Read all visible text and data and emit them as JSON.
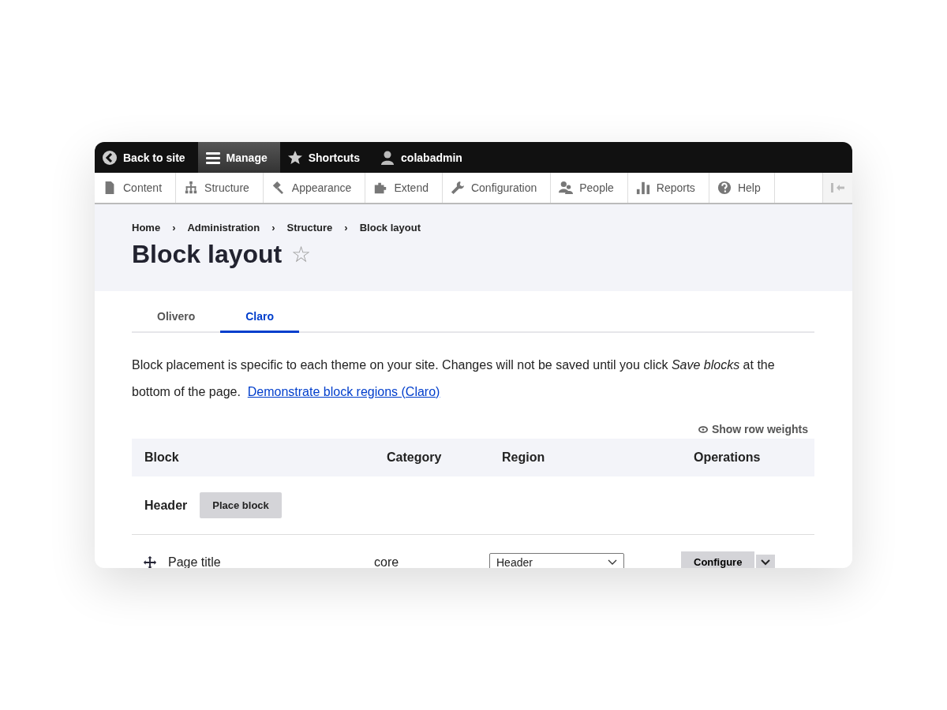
{
  "toolbar": {
    "items": [
      {
        "label": "Back to site",
        "selected": false
      },
      {
        "label": "Manage",
        "selected": true
      },
      {
        "label": "Shortcuts",
        "selected": false
      },
      {
        "label": "colabadmin",
        "selected": false
      }
    ]
  },
  "menu": {
    "items": [
      {
        "label": "Content"
      },
      {
        "label": "Structure"
      },
      {
        "label": "Appearance"
      },
      {
        "label": "Extend"
      },
      {
        "label": "Configuration"
      },
      {
        "label": "People"
      },
      {
        "label": "Reports"
      },
      {
        "label": "Help"
      }
    ]
  },
  "breadcrumb": [
    "Home",
    "Administration",
    "Structure",
    "Block layout"
  ],
  "breadcrumb_separator": "›",
  "page_title": "Block layout",
  "favorite_star": "☆",
  "tabs": [
    {
      "label": "Olivero",
      "selected": false
    },
    {
      "label": "Claro",
      "selected": true
    }
  ],
  "intro": {
    "text": "Block placement is specific to each theme on your site. Changes will not be saved until you click *Save blocks* at the bottom of the page.",
    "link": "Demonstrate block regions (Claro)"
  },
  "show_row_weights": "Show row weights",
  "table": {
    "columns": [
      "Block",
      "Category",
      "Region",
      "Operations"
    ],
    "region_heading": {
      "label": "Header",
      "button": "Place block"
    },
    "rows": [
      {
        "block": "Page title",
        "category": "core",
        "region": "Header",
        "operation": "Configure"
      }
    ]
  }
}
